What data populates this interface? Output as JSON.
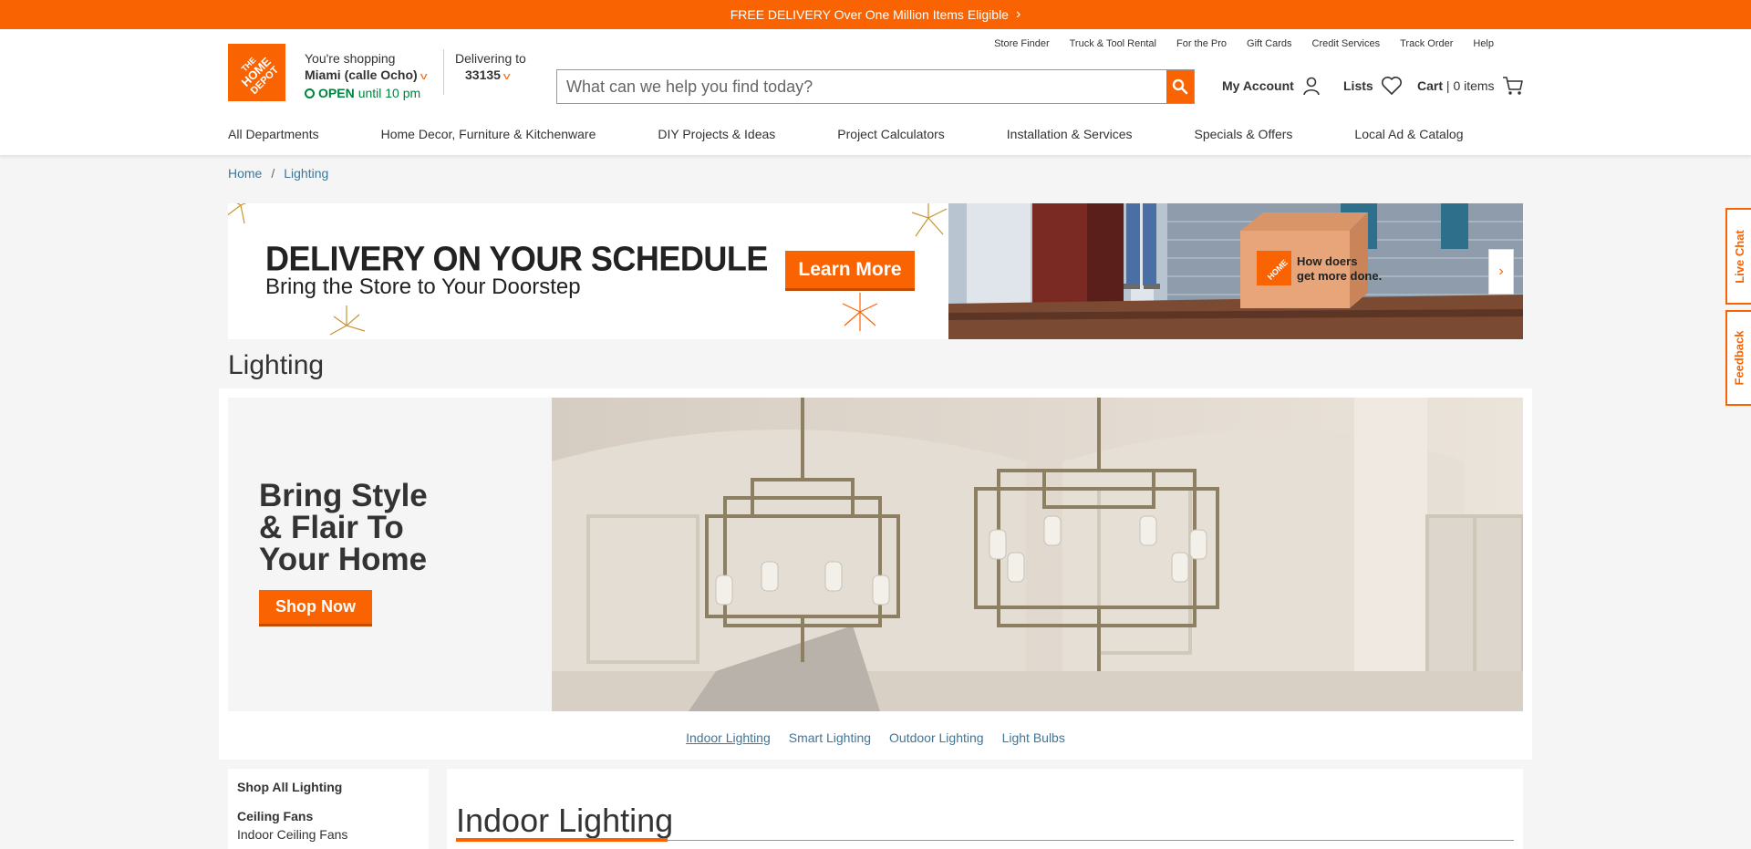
{
  "promo": {
    "text": "FREE DELIVERY Over One Million Items Eligible"
  },
  "utility_links": [
    "Store Finder",
    "Truck & Tool Rental",
    "For the Pro",
    "Gift Cards",
    "Credit Services",
    "Track Order",
    "Help"
  ],
  "store": {
    "label": "You're shopping",
    "name": "Miami (calle Ocho)",
    "status": "OPEN",
    "hours": "until 10 pm"
  },
  "delivery": {
    "label": "Delivering to",
    "zip": "33135"
  },
  "search": {
    "placeholder": "What can we help you find today?"
  },
  "account": {
    "label": "My Account"
  },
  "lists": {
    "label": "Lists"
  },
  "cart": {
    "label": "Cart",
    "separator": "|",
    "count": "0 items"
  },
  "nav": [
    "All Departments",
    "Home Decor, Furniture & Kitchenware",
    "DIY Projects & Ideas",
    "Project Calculators",
    "Installation & Services",
    "Specials & Offers",
    "Local Ad & Catalog"
  ],
  "breadcrumb": {
    "home": "Home",
    "separator": "/",
    "current": "Lighting"
  },
  "banner": {
    "headline": "DELIVERY ON YOUR SCHEDULE",
    "subhead": "Bring the Store to Your Doorstep",
    "cta": "Learn More",
    "box_text_1": "How doers",
    "box_text_2": "get more done."
  },
  "page_title": "Lighting",
  "hero": {
    "line1": "Bring Style",
    "line2": "& Flair To",
    "line3": "Your Home",
    "cta": "Shop Now"
  },
  "hero_links": [
    "Indoor Lighting",
    "Smart Lighting",
    "Outdoor Lighting",
    "Light Bulbs"
  ],
  "side_nav": {
    "heading": "Shop All Lighting",
    "section": "Ceiling Fans",
    "item": "Indoor Ceiling Fans"
  },
  "section_title": "Indoor Lighting",
  "right_tabs": {
    "chat": "Live Chat",
    "feedback": "Feedback"
  },
  "colors": {
    "brand": "#f96302",
    "link": "#3e7697",
    "open": "#00833d"
  }
}
